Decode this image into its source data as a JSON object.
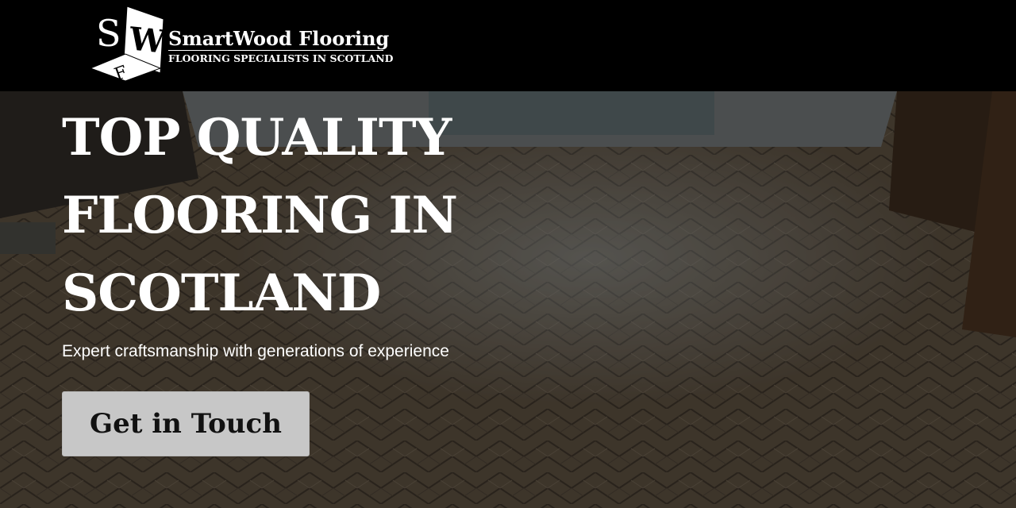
{
  "header": {
    "logo_letters": [
      "S",
      "W",
      "F"
    ],
    "brand_name": "SmartWood Flooring",
    "tagline": "FLOORING SPECIALISTS IN SCOTLAND"
  },
  "hero": {
    "title_lines": [
      "TOP QUALITY",
      "FLOORING IN",
      "SCOTLAND"
    ],
    "subtitle": "Expert craftsmanship with generations of experience",
    "cta_label": "Get in Touch"
  },
  "colors": {
    "header_bg": "#000000",
    "button_bg": "#c7c7c7",
    "text_light": "#ffffff"
  }
}
